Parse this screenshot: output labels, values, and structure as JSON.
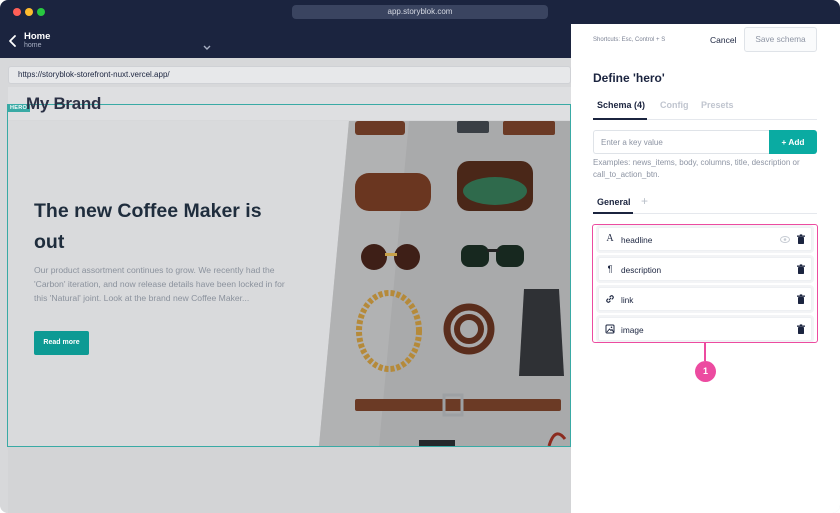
{
  "browser": {
    "url": "app.storyblok.com"
  },
  "header": {
    "story_title": "Home",
    "story_slug": "home"
  },
  "preview": {
    "address": "https://storyblok-storefront-nuxt.vercel.app/",
    "brand": "My Brand",
    "hero_tag": "HERO",
    "headline": "The new Coffee Maker is out",
    "description": "Our product assortment continues to grow. We recently had the 'Carbon' iteration, and now release details have been locked in for this 'Natural' joint. Look at the brand new Coffee Maker...",
    "button_label": "Read more"
  },
  "panel": {
    "shortcuts": "Shortcuts: Esc, Control + S",
    "cancel_label": "Cancel",
    "save_label": "Save schema",
    "title": "Define 'hero'",
    "tabs": [
      {
        "label": "Schema (4)"
      },
      {
        "label": "Config"
      },
      {
        "label": "Presets"
      }
    ],
    "key_placeholder": "Enter a key value",
    "add_label": "+ Add",
    "examples": "Examples: news_items, body, columns, title, description or call_to_action_btn.",
    "subtab_label": "General",
    "subtab_add": "+",
    "fields": [
      {
        "name": "headline",
        "icon": "text-type-icon"
      },
      {
        "name": "description",
        "icon": "paragraph-icon"
      },
      {
        "name": "link",
        "icon": "link-icon"
      },
      {
        "name": "image",
        "icon": "image-icon"
      }
    ],
    "callout_number": "1"
  },
  "colors": {
    "navy": "#1b243f",
    "teal": "#0aaba2",
    "highlight_pink": "#ec4ba0"
  }
}
